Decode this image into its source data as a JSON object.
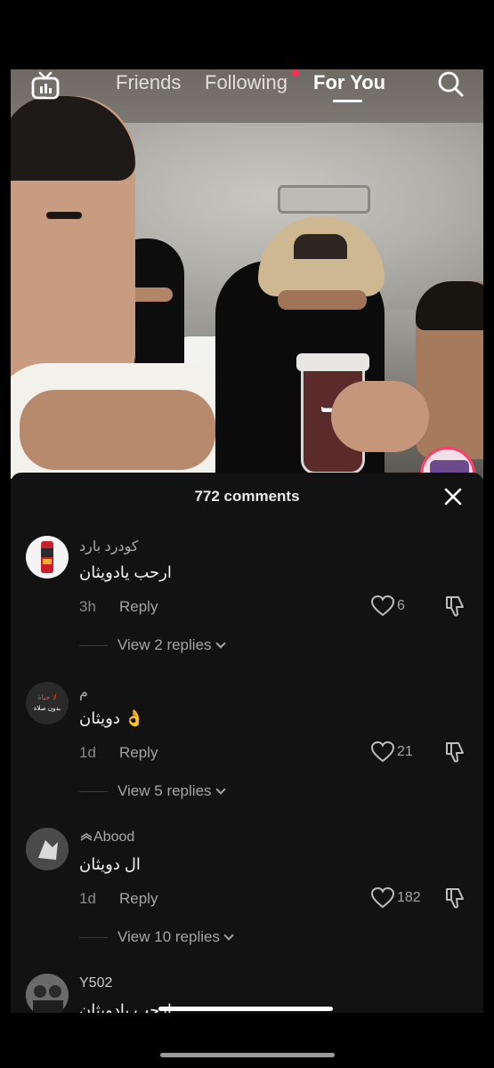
{
  "nav": {
    "tabs": [
      {
        "label": "Friends"
      },
      {
        "label": "Following"
      },
      {
        "label": "For You"
      }
    ],
    "live_icon": "tv-icon",
    "search_icon": "search-icon"
  },
  "video": {
    "cup_logo": "ℸ"
  },
  "comments_panel": {
    "title": "772 comments",
    "comments": [
      {
        "username": "كودرد بارد",
        "text": "ارحب يادويثان",
        "time": "3h",
        "reply_label": "Reply",
        "likes": "6",
        "view_replies": "View 2 replies"
      },
      {
        "username": "م",
        "text": "دويثان 👌",
        "time": "1d",
        "reply_label": "Reply",
        "likes": "21",
        "view_replies": "View 5 replies",
        "avatar_text": "لا حياة بدون صلاة"
      },
      {
        "username": "Abood",
        "text": "ال دويثان",
        "time": "1d",
        "reply_label": "Reply",
        "likes": "182",
        "view_replies": "View 10 replies"
      },
      {
        "username": "Y502",
        "text": "ارحب يادويثان"
      }
    ]
  },
  "colors": {
    "panel_bg": "#121212",
    "accent_red": "#fe2c55",
    "text_muted": "#a5a5a5"
  }
}
